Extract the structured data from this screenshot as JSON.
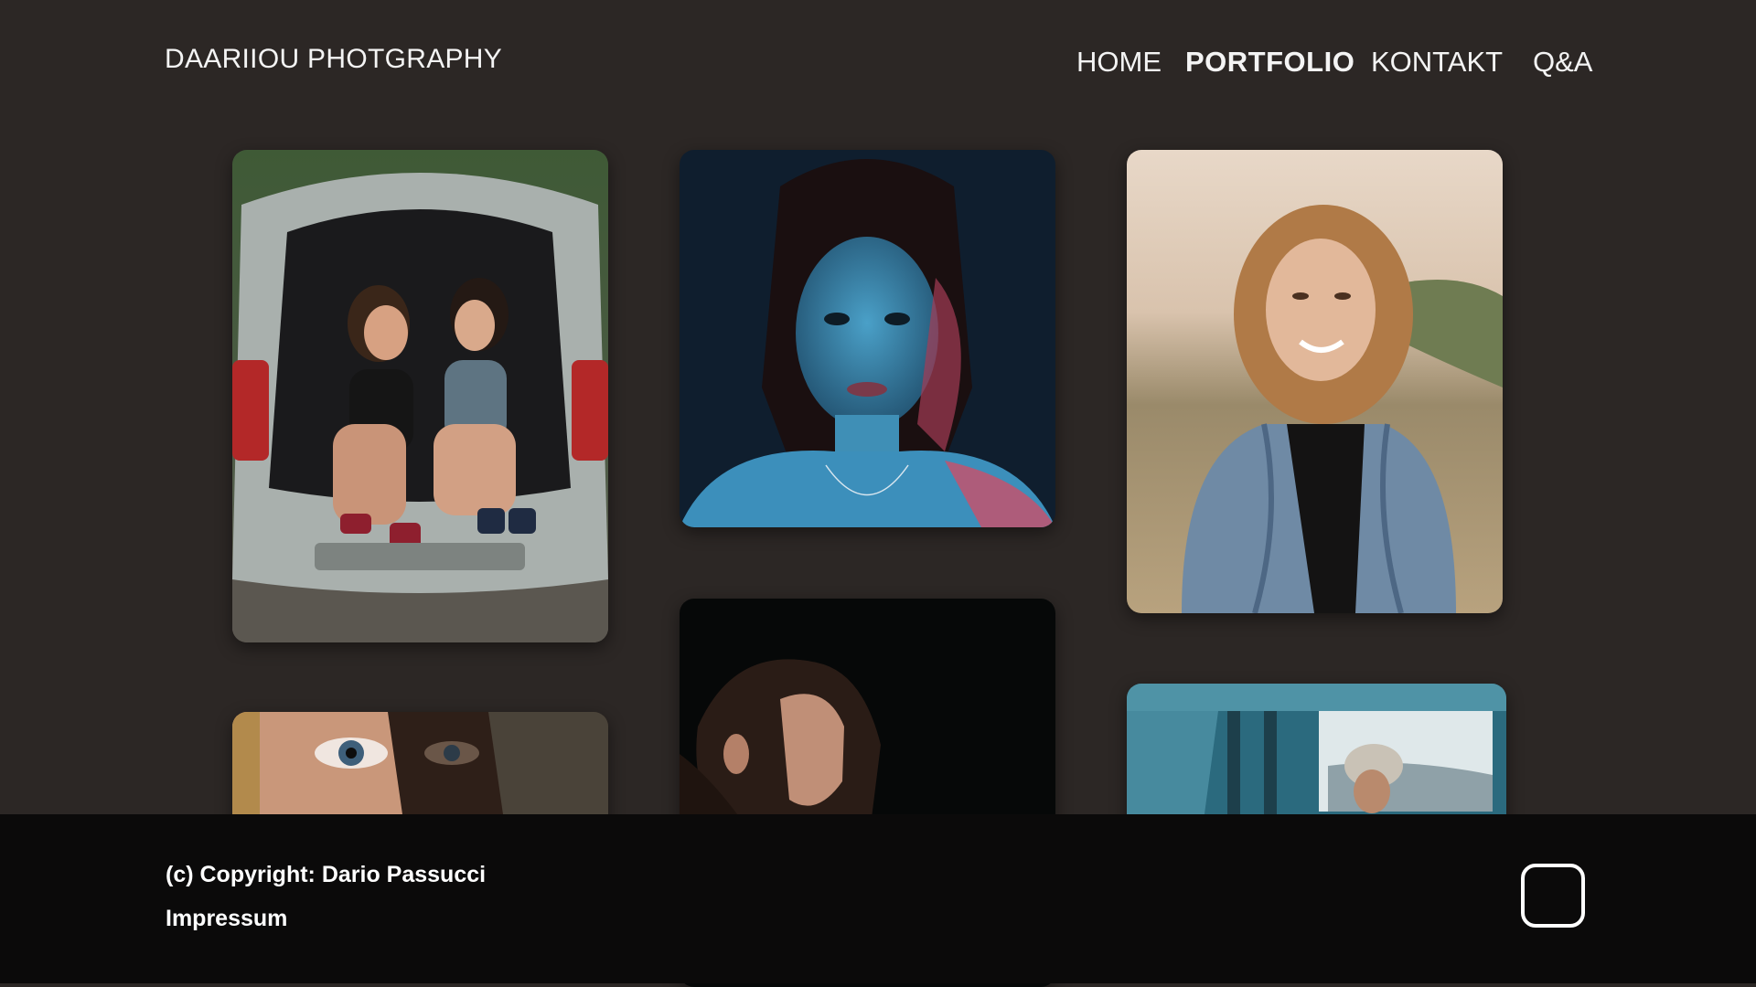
{
  "header": {
    "brand": "DAARIIOU PHOTGRAPHY",
    "nav": [
      {
        "label": "HOME",
        "active": false
      },
      {
        "label": "PORTFOLIO",
        "active": true
      },
      {
        "label": "KONTAKT",
        "active": false
      },
      {
        "label": "Q&A",
        "active": false
      }
    ]
  },
  "gallery": {
    "photos": [
      {
        "subject": "two women sitting in car trunk"
      },
      {
        "subject": "woman portrait blue and red light"
      },
      {
        "subject": "smiling woman in denim jacket outdoors"
      },
      {
        "subject": "woman eye close-up"
      },
      {
        "subject": "woman profile on dark background"
      },
      {
        "subject": "woman in van with beanie"
      }
    ]
  },
  "footer": {
    "copyright": "(c) Copyright: Dario Passucci",
    "impressum": "Impressum"
  },
  "colors": {
    "background": "#2c2725",
    "footer": "#0b0a0a",
    "text": "#ffffff"
  }
}
